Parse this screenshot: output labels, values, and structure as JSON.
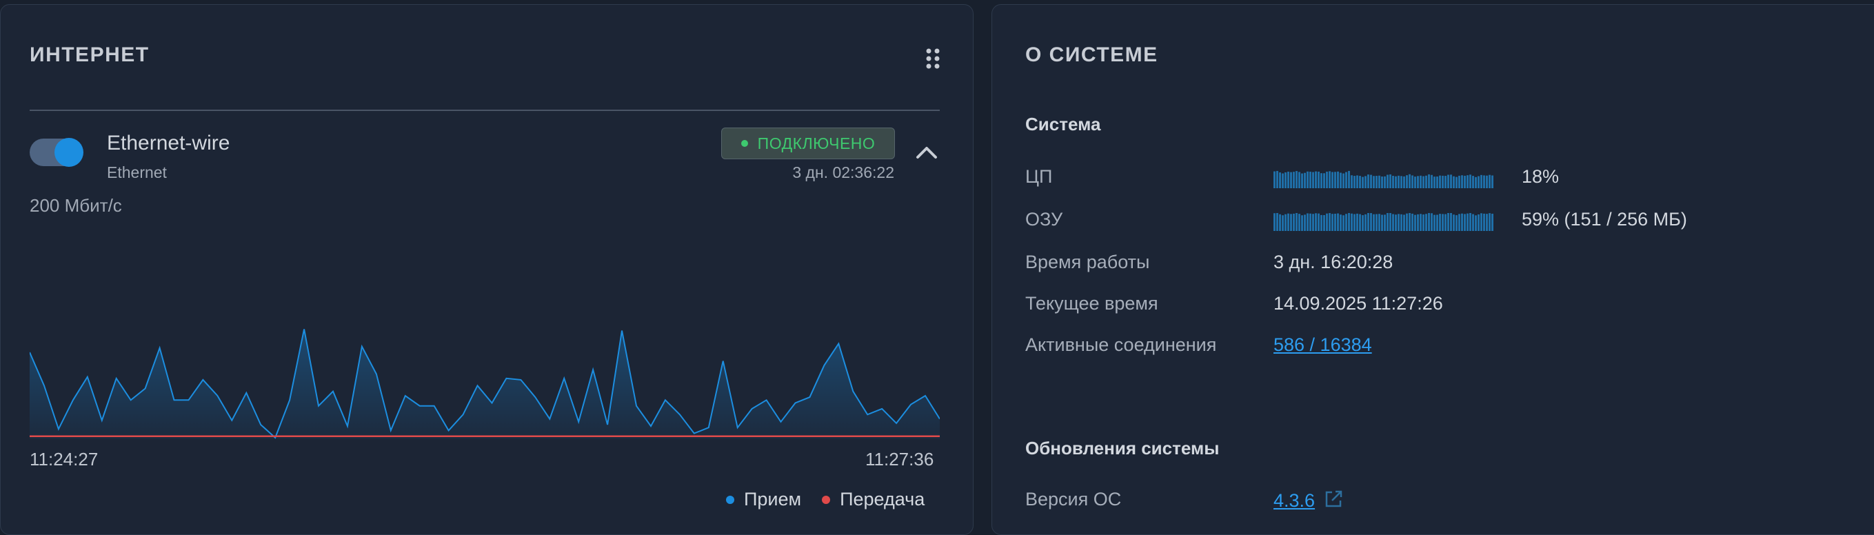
{
  "internet": {
    "title": "ИНТЕРНЕТ",
    "interface": {
      "name": "Ethernet-wire",
      "type": "Ethernet",
      "enabled": true,
      "status": "ПОДКЛЮЧЕНО",
      "uptime": "3 дн. 02:36:22",
      "speed": "200 Мбит/с"
    },
    "chart": {
      "time_start": "11:24:27",
      "time_end": "11:27:36",
      "legend": {
        "rx": "Прием",
        "tx": "Передача"
      },
      "colors": {
        "rx": "#1c8ee0",
        "tx": "#e04a4a"
      }
    }
  },
  "chart_data": {
    "type": "area",
    "x_start": "11:24:27",
    "x_end": "11:27:36",
    "series": [
      {
        "name": "Прием",
        "color": "#1c8ee0",
        "values": [
          0.6,
          0.37,
          0.07,
          0.27,
          0.43,
          0.13,
          0.42,
          0.27,
          0.35,
          0.63,
          0.27,
          0.27,
          0.41,
          0.3,
          0.13,
          0.32,
          0.1,
          0.01,
          0.27,
          0.76,
          0.23,
          0.33,
          0.09,
          0.64,
          0.45,
          0.06,
          0.3,
          0.23,
          0.23,
          0.06,
          0.17,
          0.37,
          0.25,
          0.42,
          0.41,
          0.29,
          0.14,
          0.42,
          0.12,
          0.48,
          0.1,
          0.75,
          0.23,
          0.09,
          0.27,
          0.17,
          0.04,
          0.08,
          0.54,
          0.08,
          0.21,
          0.27,
          0.12,
          0.25,
          0.29,
          0.51,
          0.66,
          0.33,
          0.17,
          0.21,
          0.11,
          0.24,
          0.3,
          0.14
        ]
      },
      {
        "name": "Передача",
        "color": "#e04a4a",
        "values": [
          0.02,
          0.02,
          0.02,
          0.02,
          0.02,
          0.02,
          0.02,
          0.02,
          0.02,
          0.02,
          0.02,
          0.02,
          0.02,
          0.02,
          0.02,
          0.02,
          0.02,
          0.02,
          0.02,
          0.02,
          0.02,
          0.02,
          0.02,
          0.02,
          0.02,
          0.02,
          0.02,
          0.02,
          0.02,
          0.02,
          0.02,
          0.02,
          0.02,
          0.02,
          0.02,
          0.02,
          0.02,
          0.02,
          0.02,
          0.02,
          0.02,
          0.02,
          0.02,
          0.02,
          0.02,
          0.02,
          0.02,
          0.02,
          0.02,
          0.02,
          0.02,
          0.02,
          0.02,
          0.02,
          0.02,
          0.02,
          0.02,
          0.02,
          0.02,
          0.02,
          0.02,
          0.02,
          0.02,
          0.02
        ]
      }
    ],
    "grid": false,
    "legend_position": "bottom-right"
  },
  "system": {
    "title": "О СИСТЕМЕ",
    "section_system": "Система",
    "cpu": {
      "label": "ЦП",
      "value": "18%",
      "fraction": 0.18
    },
    "ram": {
      "label": "ОЗУ",
      "value": "59% (151 / 256 МБ)",
      "fraction": 0.59
    },
    "uptime": {
      "label": "Время работы",
      "value": "3 дн. 16:20:28"
    },
    "current_time": {
      "label": "Текущее время",
      "value": "14.09.2025 11:27:26"
    },
    "connections": {
      "label": "Активные соединения",
      "value": "586 / 16384"
    },
    "section_updates": "Обновления системы",
    "os_version": {
      "label": "Версия ОС",
      "value": "4.3.6"
    },
    "bar_color": "#1f6fa8"
  }
}
